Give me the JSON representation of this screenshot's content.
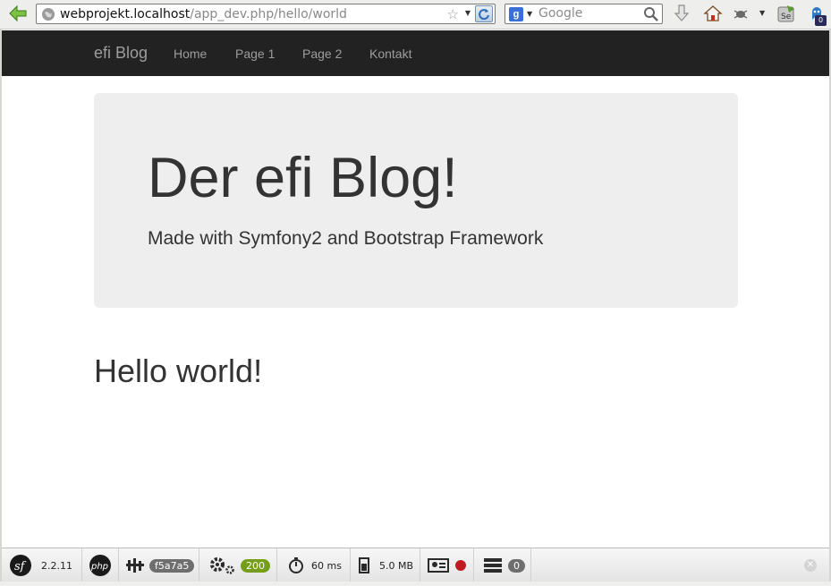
{
  "browser": {
    "url_host": "webprojekt.localhost",
    "url_path": "/app_dev.php/hello/world",
    "search_placeholder": "Google",
    "addon_badge": "0"
  },
  "nav": {
    "brand": "efi Blog",
    "links": [
      "Home",
      "Page 1",
      "Page 2",
      "Kontakt"
    ]
  },
  "jumbotron": {
    "title": "Der efi Blog!",
    "lead": "Made with Symfony2 and Bootstrap Framework"
  },
  "content": {
    "heading": "Hello world!"
  },
  "debug_toolbar": {
    "symfony_version": "2.2.11",
    "token": "f5a7a5",
    "status_code": "200",
    "time": "60 ms",
    "memory": "5.0 MB",
    "db_queries": "0",
    "colors": {
      "status_ok": "#759e1a",
      "token_bg": "#6e6e6e",
      "security_dot": "#c0191f"
    }
  }
}
